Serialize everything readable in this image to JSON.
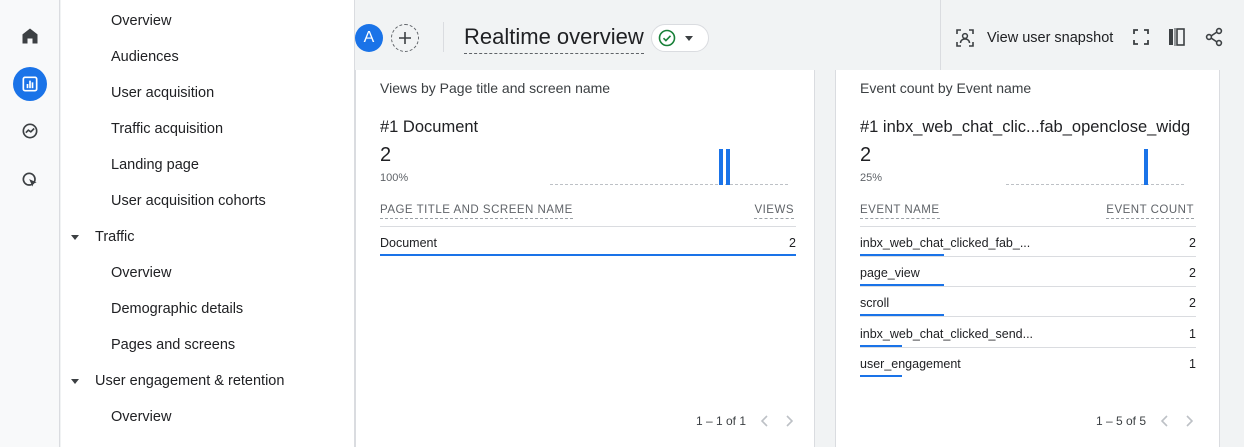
{
  "header": {
    "avatar_letter": "A",
    "title": "Realtime overview",
    "snapshot_label": "View user snapshot"
  },
  "sidebar": {
    "items": [
      {
        "label": "Overview",
        "type": "child"
      },
      {
        "label": "Audiences",
        "type": "child"
      },
      {
        "label": "User acquisition",
        "type": "child"
      },
      {
        "label": "Traffic acquisition",
        "type": "child"
      },
      {
        "label": "Landing page",
        "type": "child"
      },
      {
        "label": "User acquisition cohorts",
        "type": "child"
      },
      {
        "label": "Traffic",
        "type": "section"
      },
      {
        "label": "Overview",
        "type": "child"
      },
      {
        "label": "Demographic details",
        "type": "child"
      },
      {
        "label": "Pages and screens",
        "type": "child"
      },
      {
        "label": "User engagement & retention",
        "type": "section"
      },
      {
        "label": "Overview",
        "type": "child"
      }
    ]
  },
  "cards": [
    {
      "title": "Views by Page title and screen name",
      "top_rank": "#1  Document",
      "top_value": "2",
      "top_pct": "100%",
      "col_name": "PAGE TITLE AND SCREEN NAME",
      "col_value": "VIEWS",
      "rows": [
        {
          "name": "Document",
          "value": "2",
          "share": 1.0
        }
      ],
      "pager": "1 – 1 of 1"
    },
    {
      "title": "Event count by Event name",
      "top_rank": "#1  inbx_web_chat_clic...fab_openclose_widg",
      "top_value": "2",
      "top_pct": "25%",
      "col_name": "EVENT NAME",
      "col_value": "EVENT COUNT",
      "rows": [
        {
          "name": "inbx_web_chat_clicked_fab_...",
          "value": "2",
          "share": 0.25
        },
        {
          "name": "page_view",
          "value": "2",
          "share": 0.25
        },
        {
          "name": "scroll",
          "value": "2",
          "share": 0.25
        },
        {
          "name": "inbx_web_chat_clicked_send...",
          "value": "1",
          "share": 0.125
        },
        {
          "name": "user_engagement",
          "value": "1",
          "share": 0.125
        }
      ],
      "pager": "1 – 5 of 5"
    }
  ],
  "colors": {
    "accent": "#1a73e8",
    "status_ok": "#188038"
  }
}
